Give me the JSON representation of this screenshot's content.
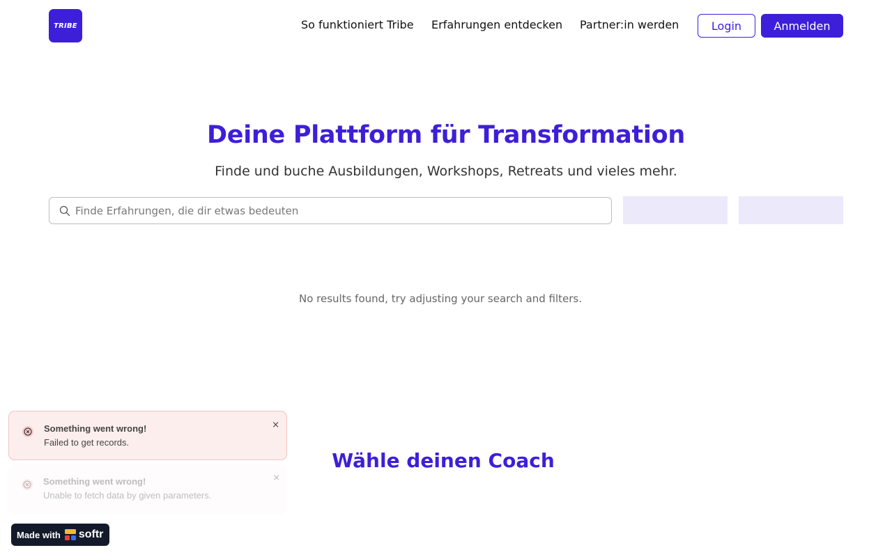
{
  "header": {
    "logo_text": "TRIBE",
    "nav": [
      {
        "label": "So funktioniert Tribe"
      },
      {
        "label": "Erfahrungen entdecken"
      },
      {
        "label": "Partner:in werden"
      }
    ],
    "login_label": "Login",
    "signup_label": "Anmelden"
  },
  "hero": {
    "title": "Deine Plattform für Transformation",
    "subtitle": "Finde und buche Ausbildungen, Workshops, Retreats und vieles mehr.",
    "search_placeholder": "Finde Erfahrungen, die dir etwas bedeuten",
    "search_value": ""
  },
  "results": {
    "empty_message": "No results found, try adjusting your search and filters."
  },
  "coach_section": {
    "title": "Wähle deinen Coach"
  },
  "toasts": [
    {
      "title": "Something went wrong!",
      "message": "Failed to get records.",
      "close": "×"
    },
    {
      "title": "Something went wrong!",
      "message": "Unable to fetch data by given parameters.",
      "close": "×"
    }
  ],
  "badge": {
    "made_with": "Made with",
    "brand": "softr"
  },
  "colors": {
    "brand": "#3d1fd9",
    "filter_bg": "#ece9fb",
    "error_bg": "#fdeeee",
    "error_icon": "#e0464b",
    "badge_bg": "#131a2a"
  },
  "icons": {
    "search": "search-icon",
    "error": "error-circle-icon",
    "close": "close-icon",
    "softr_logo": "softr-logo-icon"
  }
}
